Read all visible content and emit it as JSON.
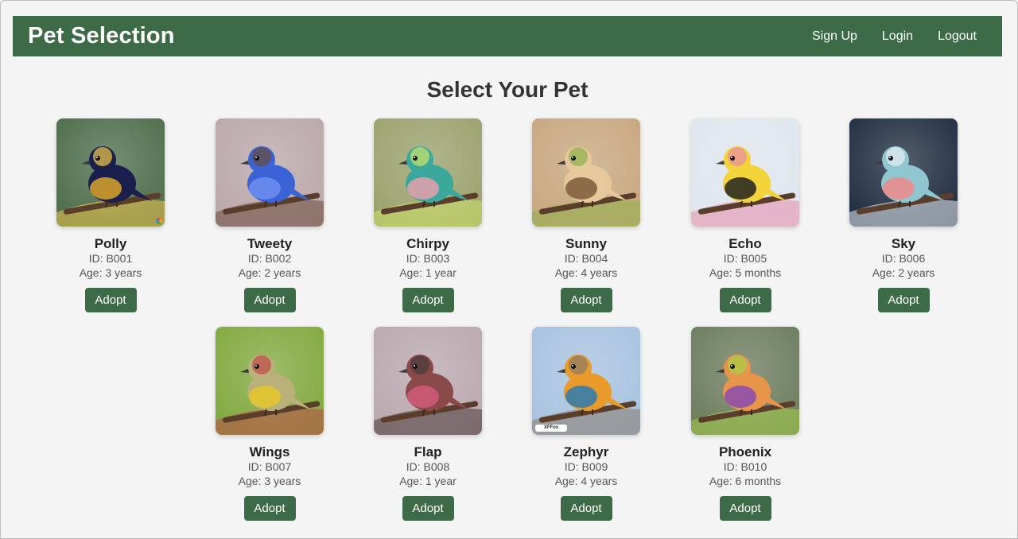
{
  "navbar": {
    "brand": "Pet Selection",
    "links": [
      "Sign Up",
      "Login",
      "Logout"
    ]
  },
  "page": {
    "heading": "Select Your Pet"
  },
  "labels": {
    "adopt": "Adopt"
  },
  "pets": [
    {
      "name": "Polly",
      "id": "ID: B001",
      "age": "Age: 3 years",
      "colors": [
        "#4a6b48",
        "#1a1f4d",
        "#d9a52a",
        "#f2c94c"
      ],
      "watermark": ""
    },
    {
      "name": "Tweety",
      "id": "ID: B002",
      "age": "Age: 2 years",
      "colors": [
        "#b9a6a8",
        "#3b63d6",
        "#6e8ef0",
        "#6b4a38"
      ],
      "watermark": ""
    },
    {
      "name": "Chirpy",
      "id": "ID: B003",
      "age": "Age: 1 year",
      "colors": [
        "#9aa06a",
        "#3aa89b",
        "#e8a0ab",
        "#cfe36a"
      ],
      "watermark": ""
    },
    {
      "name": "Sunny",
      "id": "ID: B004",
      "age": "Age: 4 years",
      "colors": [
        "#c7a67c",
        "#e6c89a",
        "#7a5a3a",
        "#8fb04a"
      ],
      "watermark": ""
    },
    {
      "name": "Echo",
      "id": "ID: B005",
      "age": "Age: 5 months",
      "colors": [
        "#dfe6ee",
        "#f2d33a",
        "#222222",
        "#e88aa8"
      ],
      "watermark": ""
    },
    {
      "name": "Sky",
      "id": "ID: B006",
      "age": "Age: 2 years",
      "colors": [
        "#1c2a3e",
        "#8fc6cf",
        "#f08a8a",
        "#e9eef2"
      ],
      "watermark": ""
    },
    {
      "name": "Wings",
      "id": "ID: B007",
      "age": "Age: 3 years",
      "colors": [
        "#7fa83a",
        "#b9b07a",
        "#e6c62a",
        "#c04a4a"
      ],
      "watermark": ""
    },
    {
      "name": "Flap",
      "id": "ID: B008",
      "age": "Age: 1 year",
      "colors": [
        "#b9a7ad",
        "#8a4a4a",
        "#d05a7a",
        "#4a3a3a"
      ],
      "watermark": ""
    },
    {
      "name": "Zephyr",
      "id": "ID: B009",
      "age": "Age: 4 years",
      "colors": [
        "#a6c2e0",
        "#e89a2a",
        "#2a7ab0",
        "#8a7a6a"
      ],
      "watermark": "XFFox"
    },
    {
      "name": "Phoenix",
      "id": "ID: B010",
      "age": "Age: 6 months",
      "colors": [
        "#6a7a5a",
        "#e8944a",
        "#8a4ab0",
        "#a6d24a"
      ],
      "watermark": ""
    }
  ],
  "theme": {
    "primary": "#3d6b47",
    "background": "#f4f4f4"
  }
}
